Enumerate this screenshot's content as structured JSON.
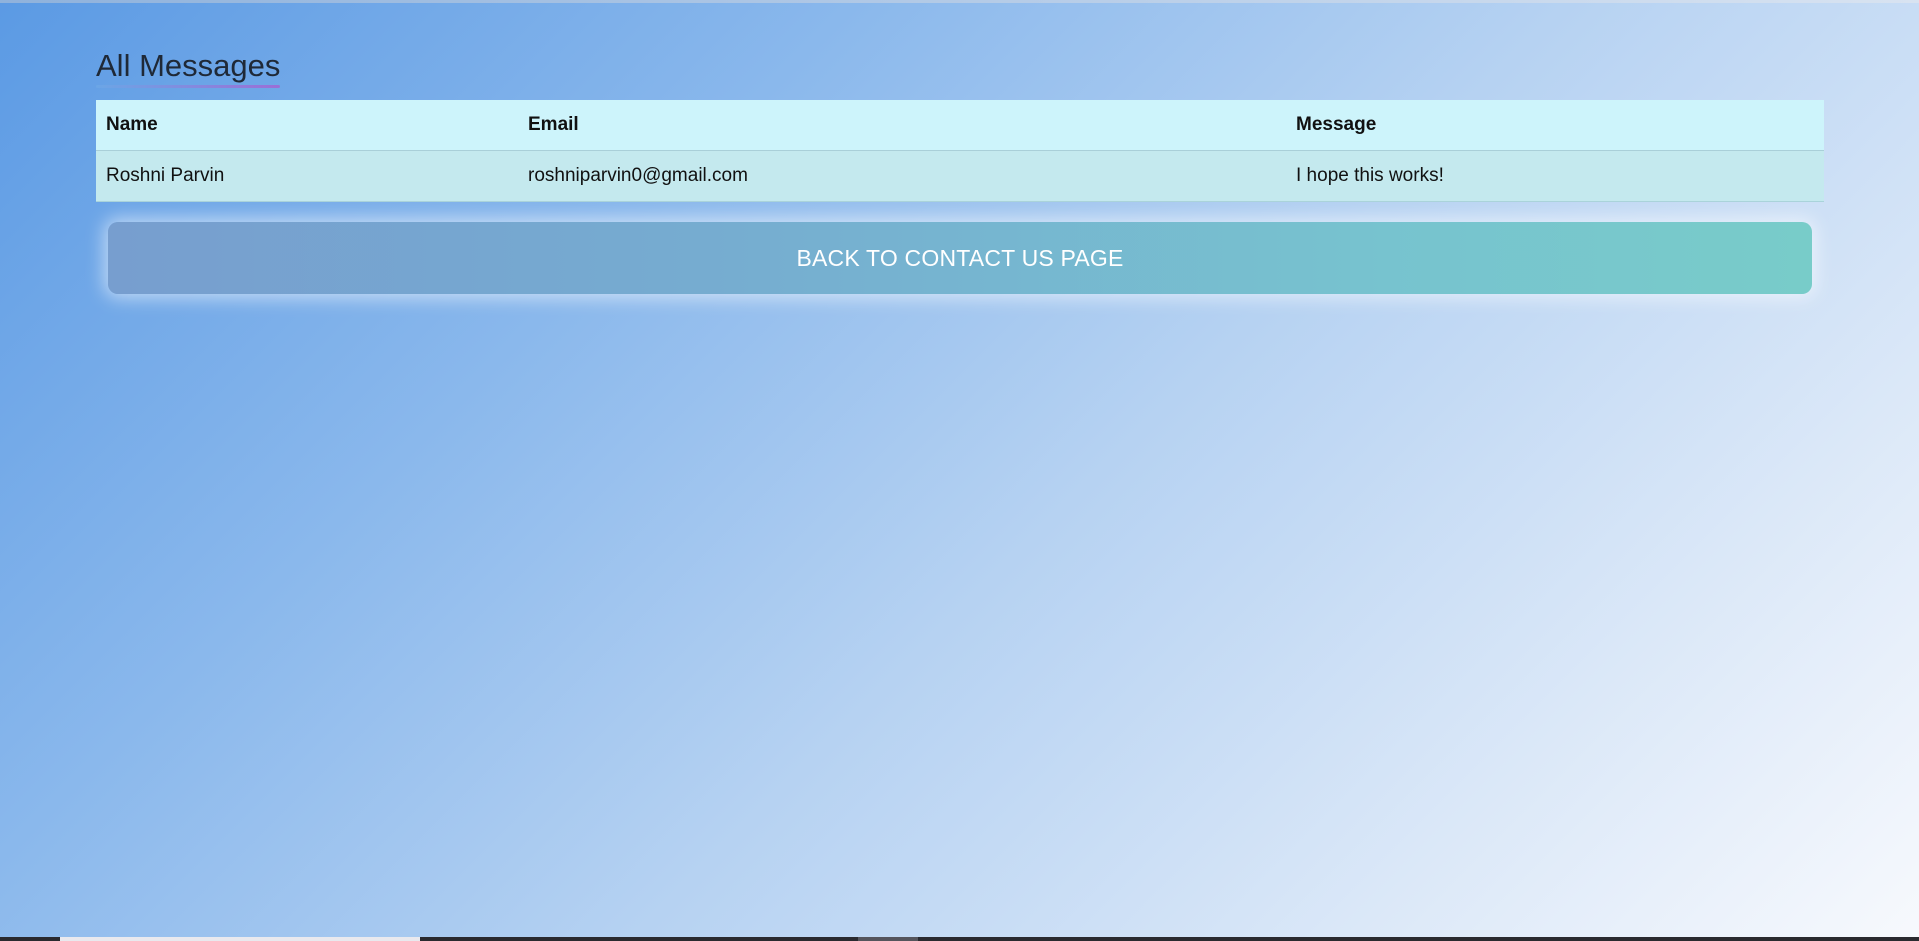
{
  "page": {
    "title": "All Messages"
  },
  "table": {
    "headers": [
      "Name",
      "Email",
      "Message"
    ],
    "rows": [
      {
        "name": "Roshni Parvin",
        "email": "roshniparvin0@gmail.com",
        "message": "I hope this works!"
      }
    ]
  },
  "actions": {
    "back_label": "BACK TO CONTACT US PAGE"
  },
  "colors": {
    "header_row": "#cdf4fb",
    "body_row": "#c4e9ee",
    "button_start": "#779ecf",
    "button_end": "#78ccc9"
  }
}
